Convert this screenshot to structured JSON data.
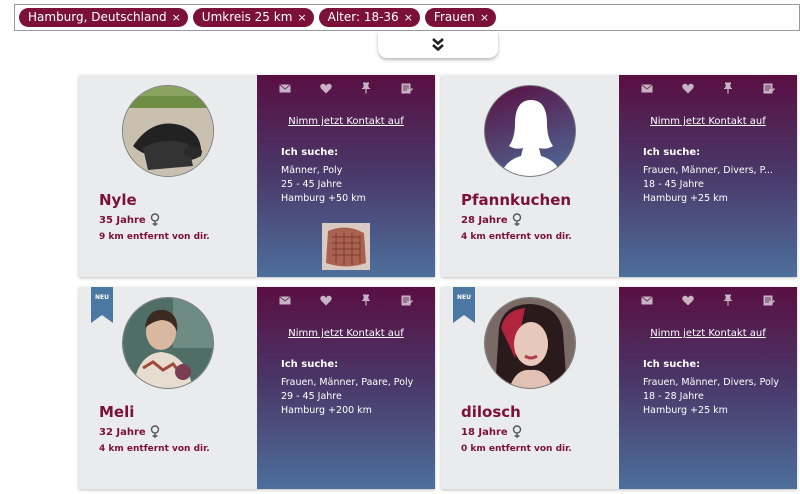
{
  "filters": [
    {
      "label": "Hamburg, Deutschland",
      "remove": "×"
    },
    {
      "label": "Umkreis 25 km",
      "remove": "×"
    },
    {
      "label": "Alter: 18-36",
      "remove": "×"
    },
    {
      "label": "Frauen",
      "remove": "×"
    }
  ],
  "expand_icon": "chevrons-down-icon",
  "contact_label": "Nimm jetzt Kontakt auf",
  "seek_title": "Ich suche:",
  "new_badge": "NEU",
  "colors": {
    "accent": "#7b1038",
    "card_left": "#eaebed",
    "grad_top": "#5a0f42",
    "grad_bottom": "#4d6f9b"
  },
  "profiles": [
    {
      "name": "Nyle",
      "age": "35 Jahre",
      "distance": "9 km entfernt von dir.",
      "seek_1": "Männer, Poly",
      "seek_2": "25 - 45 Jahre",
      "seek_3": "Hamburg +50 km"
    },
    {
      "name": "Pfannkuchen",
      "age": "28 Jahre",
      "distance": "4 km entfernt von dir.",
      "seek_1": "Frauen, Männer, Divers, P...",
      "seek_2": "18 - 45 Jahre",
      "seek_3": "Hamburg +25 km"
    },
    {
      "name": "Meli",
      "age": "32 Jahre",
      "distance": "4 km entfernt von dir.",
      "seek_1": "Frauen, Männer, Paare, Poly",
      "seek_2": "29 - 45 Jahre",
      "seek_3": "Hamburg +200 km"
    },
    {
      "name": "dilosch",
      "age": "18 Jahre",
      "distance": "0 km entfernt von dir.",
      "seek_1": "Frauen, Männer, Divers, Poly",
      "seek_2": "18 - 28 Jahre",
      "seek_3": "Hamburg +25 km"
    }
  ]
}
